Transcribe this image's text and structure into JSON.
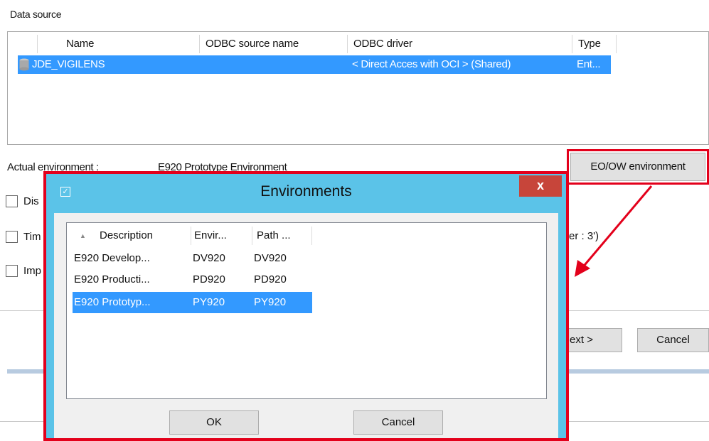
{
  "wizard": {
    "data_source_label": "Data source",
    "columns": [
      "Name",
      "ODBC source name",
      "ODBC driver",
      "Type"
    ],
    "rows": [
      {
        "name": "JDE_VIGILENS",
        "odbc_source": "",
        "driver": "< Direct Acces with OCI > (Shared)",
        "type": "Ent..."
      }
    ],
    "actual_env_label": "Actual environment :",
    "actual_env_value": "E920 Prototype Environment",
    "eo_button": "EO/OW environment",
    "checkboxes": [
      "Dis",
      "Tim",
      "Imp"
    ],
    "side_text": "er :  3')",
    "next_button": "ext >",
    "cancel_button": "Cancel"
  },
  "dialog": {
    "title": "Environments",
    "close_label": "x",
    "columns": [
      "Description",
      "Envir...",
      "Path ..."
    ],
    "rows": [
      {
        "description": "E920 Develop...",
        "env": "DV920",
        "path": "DV920",
        "selected": false
      },
      {
        "description": "E920 Producti...",
        "env": "PD920",
        "path": "PD920",
        "selected": false
      },
      {
        "description": "E920 Prototyp...",
        "env": "PY920",
        "path": "PY920",
        "selected": true
      }
    ],
    "ok_button": "OK",
    "cancel_button": "Cancel"
  },
  "colors": {
    "highlight": "#e3001b",
    "selection": "#3399ff",
    "dialog_frame": "#5bc3e8"
  },
  "icons": [
    "database-icon",
    "checkbox-icon",
    "sort-up-icon",
    "close-icon"
  ]
}
